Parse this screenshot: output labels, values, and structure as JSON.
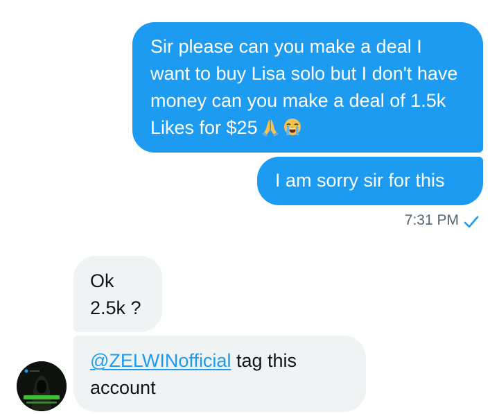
{
  "conversation": {
    "messages": [
      {
        "direction": "sent",
        "text": "Sir please can you make a deal I want to buy Lisa solo but I don't have money can you make a deal of 1.5k Likes for $25",
        "emojis": [
          "folded-hands",
          "loudly-crying-face"
        ]
      },
      {
        "direction": "sent",
        "text": "I am sorry sir for this"
      },
      {
        "direction": "received",
        "lines": [
          "Ok",
          "2.5k ?"
        ]
      },
      {
        "direction": "received",
        "mention": "@ZELWINofficial",
        "text": " tag this account"
      }
    ],
    "sent_timestamp": "7:31 PM",
    "read_receipt_icon": "checkmark-icon"
  },
  "colors": {
    "sent_bubble": "#1d9bf0",
    "received_bubble": "#eff3f4",
    "mention": "#1d9bf0",
    "timestamp": "#536471",
    "avatar_accent": "#3fbf2f"
  }
}
